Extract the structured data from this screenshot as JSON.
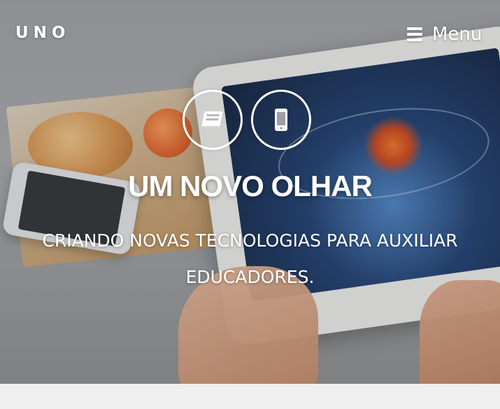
{
  "brand": {
    "name": "UNO"
  },
  "nav": {
    "menu_label": "Menu",
    "menu_icon": "hamburger-icon"
  },
  "hero": {
    "icons": [
      "book-icon",
      "mobile-phone-icon"
    ],
    "headline": "UM NOVO OLHAR",
    "tagline": "CRIANDO NOVAS TECNOLOGIAS PARA AUXILIAR EDUCADORES."
  },
  "colors": {
    "text": "#ffffff",
    "below_hero_background": "#efefef"
  }
}
